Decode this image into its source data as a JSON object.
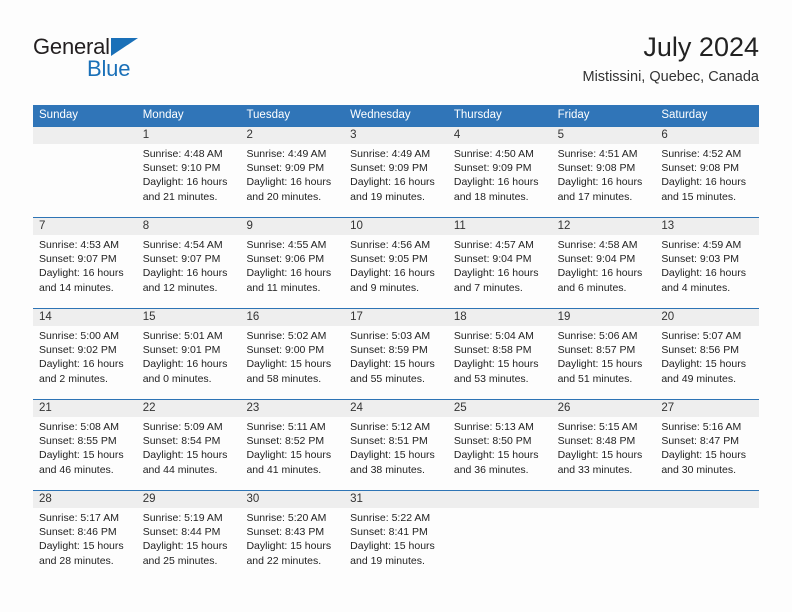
{
  "brand": {
    "name_part1": "General",
    "name_part2": "Blue",
    "triangle_icon": "triangle-icon",
    "accent_color": "#1a70b8"
  },
  "header": {
    "title": "July 2024",
    "location": "Mistissini, Quebec, Canada"
  },
  "theme": {
    "header_blue": "#3075b8",
    "row_divider_blue": "#2e74b5",
    "date_band_gray": "#eeeeee",
    "text_dark": "#222222"
  },
  "weekday_headers": [
    "Sunday",
    "Monday",
    "Tuesday",
    "Wednesday",
    "Thursday",
    "Friday",
    "Saturday"
  ],
  "weeks": [
    {
      "days": [
        {
          "date": "",
          "sunrise": "",
          "sunset": "",
          "daylight_line1": "",
          "daylight_line2": ""
        },
        {
          "date": "1",
          "sunrise": "Sunrise: 4:48 AM",
          "sunset": "Sunset: 9:10 PM",
          "daylight_line1": "Daylight: 16 hours",
          "daylight_line2": "and 21 minutes."
        },
        {
          "date": "2",
          "sunrise": "Sunrise: 4:49 AM",
          "sunset": "Sunset: 9:09 PM",
          "daylight_line1": "Daylight: 16 hours",
          "daylight_line2": "and 20 minutes."
        },
        {
          "date": "3",
          "sunrise": "Sunrise: 4:49 AM",
          "sunset": "Sunset: 9:09 PM",
          "daylight_line1": "Daylight: 16 hours",
          "daylight_line2": "and 19 minutes."
        },
        {
          "date": "4",
          "sunrise": "Sunrise: 4:50 AM",
          "sunset": "Sunset: 9:09 PM",
          "daylight_line1": "Daylight: 16 hours",
          "daylight_line2": "and 18 minutes."
        },
        {
          "date": "5",
          "sunrise": "Sunrise: 4:51 AM",
          "sunset": "Sunset: 9:08 PM",
          "daylight_line1": "Daylight: 16 hours",
          "daylight_line2": "and 17 minutes."
        },
        {
          "date": "6",
          "sunrise": "Sunrise: 4:52 AM",
          "sunset": "Sunset: 9:08 PM",
          "daylight_line1": "Daylight: 16 hours",
          "daylight_line2": "and 15 minutes."
        }
      ]
    },
    {
      "days": [
        {
          "date": "7",
          "sunrise": "Sunrise: 4:53 AM",
          "sunset": "Sunset: 9:07 PM",
          "daylight_line1": "Daylight: 16 hours",
          "daylight_line2": "and 14 minutes."
        },
        {
          "date": "8",
          "sunrise": "Sunrise: 4:54 AM",
          "sunset": "Sunset: 9:07 PM",
          "daylight_line1": "Daylight: 16 hours",
          "daylight_line2": "and 12 minutes."
        },
        {
          "date": "9",
          "sunrise": "Sunrise: 4:55 AM",
          "sunset": "Sunset: 9:06 PM",
          "daylight_line1": "Daylight: 16 hours",
          "daylight_line2": "and 11 minutes."
        },
        {
          "date": "10",
          "sunrise": "Sunrise: 4:56 AM",
          "sunset": "Sunset: 9:05 PM",
          "daylight_line1": "Daylight: 16 hours",
          "daylight_line2": "and 9 minutes."
        },
        {
          "date": "11",
          "sunrise": "Sunrise: 4:57 AM",
          "sunset": "Sunset: 9:04 PM",
          "daylight_line1": "Daylight: 16 hours",
          "daylight_line2": "and 7 minutes."
        },
        {
          "date": "12",
          "sunrise": "Sunrise: 4:58 AM",
          "sunset": "Sunset: 9:04 PM",
          "daylight_line1": "Daylight: 16 hours",
          "daylight_line2": "and 6 minutes."
        },
        {
          "date": "13",
          "sunrise": "Sunrise: 4:59 AM",
          "sunset": "Sunset: 9:03 PM",
          "daylight_line1": "Daylight: 16 hours",
          "daylight_line2": "and 4 minutes."
        }
      ]
    },
    {
      "days": [
        {
          "date": "14",
          "sunrise": "Sunrise: 5:00 AM",
          "sunset": "Sunset: 9:02 PM",
          "daylight_line1": "Daylight: 16 hours",
          "daylight_line2": "and 2 minutes."
        },
        {
          "date": "15",
          "sunrise": "Sunrise: 5:01 AM",
          "sunset": "Sunset: 9:01 PM",
          "daylight_line1": "Daylight: 16 hours",
          "daylight_line2": "and 0 minutes."
        },
        {
          "date": "16",
          "sunrise": "Sunrise: 5:02 AM",
          "sunset": "Sunset: 9:00 PM",
          "daylight_line1": "Daylight: 15 hours",
          "daylight_line2": "and 58 minutes."
        },
        {
          "date": "17",
          "sunrise": "Sunrise: 5:03 AM",
          "sunset": "Sunset: 8:59 PM",
          "daylight_line1": "Daylight: 15 hours",
          "daylight_line2": "and 55 minutes."
        },
        {
          "date": "18",
          "sunrise": "Sunrise: 5:04 AM",
          "sunset": "Sunset: 8:58 PM",
          "daylight_line1": "Daylight: 15 hours",
          "daylight_line2": "and 53 minutes."
        },
        {
          "date": "19",
          "sunrise": "Sunrise: 5:06 AM",
          "sunset": "Sunset: 8:57 PM",
          "daylight_line1": "Daylight: 15 hours",
          "daylight_line2": "and 51 minutes."
        },
        {
          "date": "20",
          "sunrise": "Sunrise: 5:07 AM",
          "sunset": "Sunset: 8:56 PM",
          "daylight_line1": "Daylight: 15 hours",
          "daylight_line2": "and 49 minutes."
        }
      ]
    },
    {
      "days": [
        {
          "date": "21",
          "sunrise": "Sunrise: 5:08 AM",
          "sunset": "Sunset: 8:55 PM",
          "daylight_line1": "Daylight: 15 hours",
          "daylight_line2": "and 46 minutes."
        },
        {
          "date": "22",
          "sunrise": "Sunrise: 5:09 AM",
          "sunset": "Sunset: 8:54 PM",
          "daylight_line1": "Daylight: 15 hours",
          "daylight_line2": "and 44 minutes."
        },
        {
          "date": "23",
          "sunrise": "Sunrise: 5:11 AM",
          "sunset": "Sunset: 8:52 PM",
          "daylight_line1": "Daylight: 15 hours",
          "daylight_line2": "and 41 minutes."
        },
        {
          "date": "24",
          "sunrise": "Sunrise: 5:12 AM",
          "sunset": "Sunset: 8:51 PM",
          "daylight_line1": "Daylight: 15 hours",
          "daylight_line2": "and 38 minutes."
        },
        {
          "date": "25",
          "sunrise": "Sunrise: 5:13 AM",
          "sunset": "Sunset: 8:50 PM",
          "daylight_line1": "Daylight: 15 hours",
          "daylight_line2": "and 36 minutes."
        },
        {
          "date": "26",
          "sunrise": "Sunrise: 5:15 AM",
          "sunset": "Sunset: 8:48 PM",
          "daylight_line1": "Daylight: 15 hours",
          "daylight_line2": "and 33 minutes."
        },
        {
          "date": "27",
          "sunrise": "Sunrise: 5:16 AM",
          "sunset": "Sunset: 8:47 PM",
          "daylight_line1": "Daylight: 15 hours",
          "daylight_line2": "and 30 minutes."
        }
      ]
    },
    {
      "days": [
        {
          "date": "28",
          "sunrise": "Sunrise: 5:17 AM",
          "sunset": "Sunset: 8:46 PM",
          "daylight_line1": "Daylight: 15 hours",
          "daylight_line2": "and 28 minutes."
        },
        {
          "date": "29",
          "sunrise": "Sunrise: 5:19 AM",
          "sunset": "Sunset: 8:44 PM",
          "daylight_line1": "Daylight: 15 hours",
          "daylight_line2": "and 25 minutes."
        },
        {
          "date": "30",
          "sunrise": "Sunrise: 5:20 AM",
          "sunset": "Sunset: 8:43 PM",
          "daylight_line1": "Daylight: 15 hours",
          "daylight_line2": "and 22 minutes."
        },
        {
          "date": "31",
          "sunrise": "Sunrise: 5:22 AM",
          "sunset": "Sunset: 8:41 PM",
          "daylight_line1": "Daylight: 15 hours",
          "daylight_line2": "and 19 minutes."
        },
        {
          "date": "",
          "sunrise": "",
          "sunset": "",
          "daylight_line1": "",
          "daylight_line2": ""
        },
        {
          "date": "",
          "sunrise": "",
          "sunset": "",
          "daylight_line1": "",
          "daylight_line2": ""
        },
        {
          "date": "",
          "sunrise": "",
          "sunset": "",
          "daylight_line1": "",
          "daylight_line2": ""
        }
      ]
    }
  ]
}
